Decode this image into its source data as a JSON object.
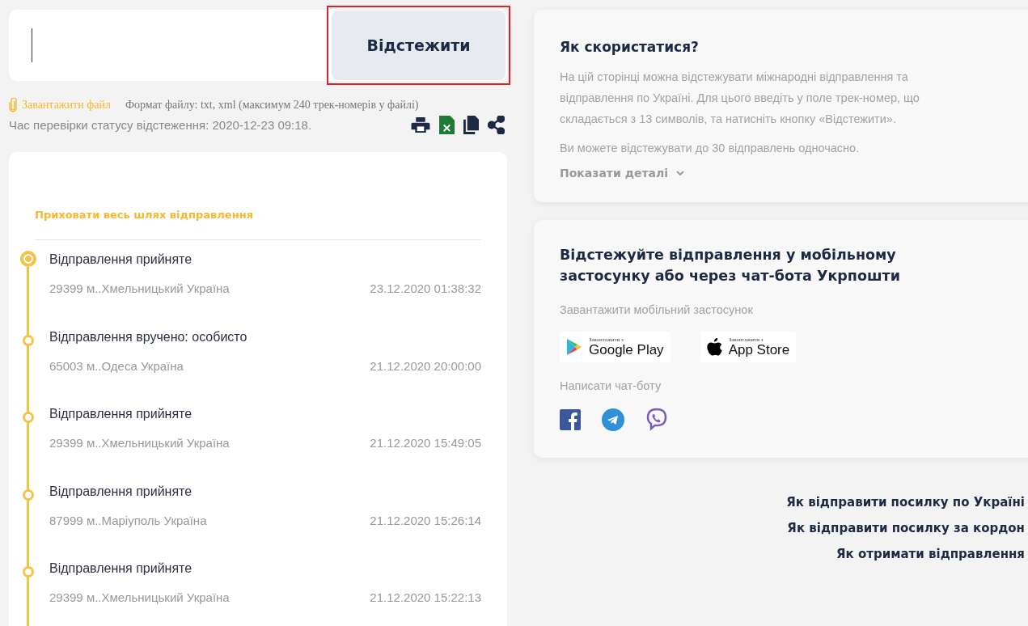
{
  "search": {
    "button": "Відстежити",
    "highlighted": true
  },
  "upload": {
    "link": "Завантажити файл",
    "format": "Формат файлу: txt, xml (максимум 240 трек-номерів у файлі)"
  },
  "check_time": "Час перевірки статусу відстеження: 2020-12-23 09:18.",
  "timeline": {
    "toggle": "Приховати весь шлях відправлення",
    "events": [
      {
        "status": "Відправлення прийняте",
        "place": "29399 м..Хмельницький Україна",
        "time": "23.12.2020 01:38:32",
        "current": true
      },
      {
        "status": "Відправлення вручено: особисто",
        "place": "65003 м..Одеса Україна",
        "time": "21.12.2020 20:00:00",
        "current": false
      },
      {
        "status": "Відправлення прийняте",
        "place": "29399 м..Хмельницький Україна",
        "time": "21.12.2020 15:49:05",
        "current": false
      },
      {
        "status": "Відправлення прийняте",
        "place": "87999 м..Маріуполь Україна",
        "time": "21.12.2020 15:26:14",
        "current": false
      },
      {
        "status": "Відправлення прийняте",
        "place": "29399 м..Хмельницький Україна",
        "time": "21.12.2020 15:22:13",
        "current": false
      }
    ]
  },
  "help": {
    "title": "Як скористатися?",
    "paragraphs": [
      "На цій сторінці можна відстежувати міжнародні відправлення та відправлення по Україні. Для цього введіть у поле трек-номер, що складається з 13 символів, та натисніть кнопку «Відстежити».",
      "Ви можете відстежувати до 30 відправлень одночасно."
    ],
    "details": "Показати деталі"
  },
  "mobile": {
    "title": "Відстежуйте відправлення у мобільному застосунку або через чат-бота Укрпошти",
    "download": "Завантажити мобільний застосунок",
    "stores": [
      {
        "kind": "google",
        "small": "Завантажити з",
        "name": "Google Play"
      },
      {
        "kind": "apple",
        "small": "Завантажити з",
        "name": "App Store"
      }
    ],
    "chatbot": "Написати чат-боту",
    "messengers": [
      {
        "kind": "facebook"
      },
      {
        "kind": "telegram"
      },
      {
        "kind": "viber"
      }
    ]
  },
  "links": [
    "Як відправити посилку по Україні",
    "Як відправити посилку за кордон",
    "Як отримати відправлення"
  ]
}
